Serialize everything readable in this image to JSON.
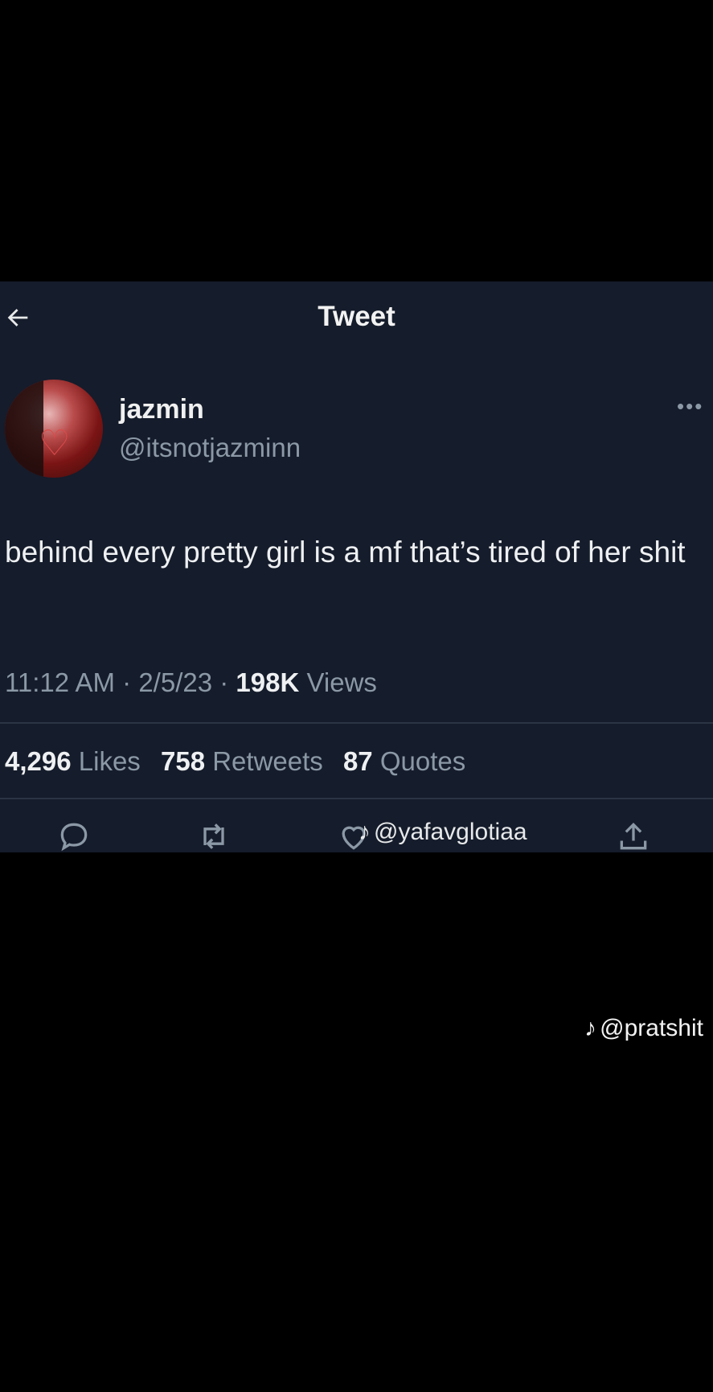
{
  "header": {
    "title": "Tweet",
    "back_icon": "arrow-left-icon"
  },
  "author": {
    "name": "jazmin",
    "handle": "@itsnotjazminn",
    "more_label": "•••"
  },
  "tweet": {
    "text": "behind every pretty girl is a mf that’s tired of her shit",
    "time": "11:12 AM",
    "date": "2/5/23",
    "views_count": "198K",
    "views_label": "Views"
  },
  "stats": {
    "likes_count": "4,296",
    "likes_label": "Likes",
    "retweets_count": "758",
    "retweets_label": "Retweets",
    "quotes_count": "87",
    "quotes_label": "Quotes"
  },
  "actions": [
    "reply-icon",
    "retweet-icon",
    "like-icon",
    "share-icon"
  ],
  "watermarks": {
    "tweet_overlay": "@yafavglotiaa",
    "bottom": "@pratshit"
  },
  "colors": {
    "background": "#000000",
    "card": "#151c2b",
    "muted": "#8b98a5",
    "text": "#e7e9ea"
  }
}
